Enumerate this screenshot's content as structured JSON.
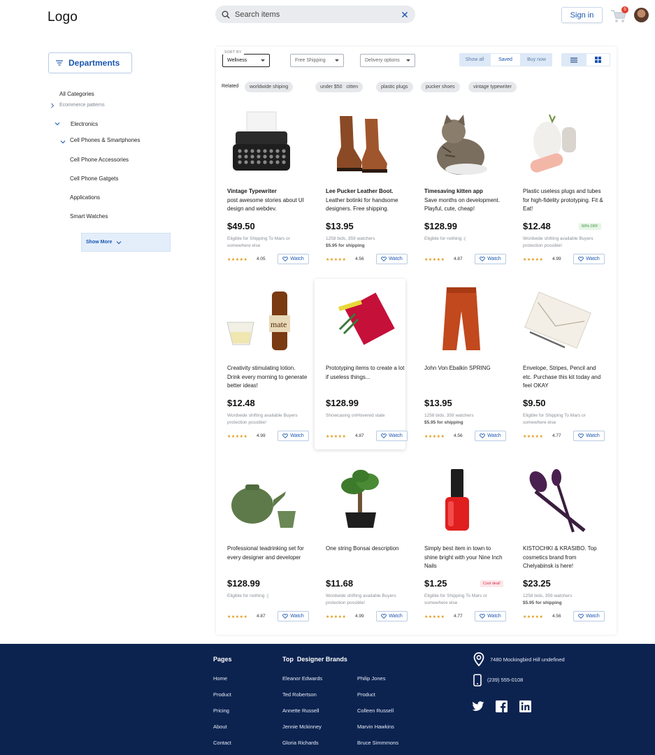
{
  "header": {
    "logo": "Logo",
    "search_placeholder": "Search items",
    "signin_label": "Sign in",
    "cart_count": "5",
    "cart_icon": "shopping-cart-icon",
    "avatar_icon": "user-avatar"
  },
  "sidebar": {
    "departments_label": "Departments",
    "all_categories": "All Categories",
    "ecommerce": "Ecommerce patterns",
    "electronics": "Electronics",
    "cell_phones": "Cell Phones & Smartphones",
    "items": [
      "Cell Phone Accessories",
      "Cell Phone Gatgets",
      "Applications",
      "Smart Watches"
    ],
    "show_more": "Show More"
  },
  "toolbar": {
    "sort_by_label": "SORT BY",
    "sort_value": "Wellness",
    "shipping_value": "Free Shipping",
    "delivery_value": "Delivery options",
    "segments": [
      "Show all",
      "Saved",
      "Buy now"
    ],
    "active_segment": "Saved"
  },
  "related": {
    "label": "Related",
    "chips": [
      "worldwide shiping",
      "under $50",
      "citten",
      "plastic plugs",
      "pucker shoes",
      "vintage typewriter"
    ]
  },
  "products": [
    {
      "title_bold": "Vintage Typewriter",
      "title_rest": "post awesome stories about UI design and webdev.",
      "price": "$49.50",
      "note": "Eligible for Shipping To Mars or somewhere else",
      "rating": "4.05",
      "watch": "Watch"
    },
    {
      "title_bold": "Lee Pucker Leather Boot.",
      "title_rest": "Leather botinki for handsome designers. Free shipping.",
      "price": "$13.95",
      "note": "1258 bids, 359 watchers",
      "note_bold": "$5.95 for shipping",
      "rating": "4.56",
      "watch": "Watch"
    },
    {
      "title_bold": "Timesaving kitten app",
      "title_rest": "Save months on development. Playful, cute, cheap!",
      "price": "$128.99",
      "note": "Eligible for nothing :(",
      "rating": "4.87",
      "watch": "Watch"
    },
    {
      "title_bold": "",
      "title_rest": "Plastic useless plugs and tubes for high-fidelity prototyping. Fit & Eat!",
      "price": "$12.48",
      "badge": "50% OFF",
      "note": "Wordwide shitting available Buyers protection possible!",
      "rating": "4.99",
      "watch": "Watch"
    },
    {
      "title_bold": "",
      "title_rest": "Creativity stimulating lotion. Drink every morning to generate better ideas!",
      "price": "$12.48",
      "note": "Wordwide shifting available Buyers protection possible!",
      "rating": "4.99",
      "watch": "Watch"
    },
    {
      "title_bold": "",
      "title_rest": "Prototyping items to create a lot if useless things...",
      "price": "$128.99",
      "note": "Showcasing onHovered state",
      "rating": "4.87",
      "watch": "Watch"
    },
    {
      "title_bold": "",
      "title_rest": "John Von Ebalkin SPRING",
      "price": "$13.95",
      "note": "1258 bids, 359 watchers",
      "note_bold": "$5.95 for shipping",
      "rating": "4.56",
      "watch": "Watch"
    },
    {
      "title_bold": "",
      "title_rest": "Envelope, Stripes, Pencil and etc. Purchase this kit today and feel OKAY",
      "price": "$9.50",
      "note": "Eligible for Shipping To Mars or somewhere else",
      "rating": "4.77",
      "watch": "Watch"
    },
    {
      "title_bold": "",
      "title_rest": "Professional teadrinking set for every designer and developer",
      "price": "$128.99",
      "note": "Eligible for nothing :(",
      "rating": "4.87",
      "watch": "Watch"
    },
    {
      "title_bold": "",
      "title_rest": "One string Bonsai description",
      "price": "$11.68",
      "note": "Wordwide shifting available Buyers protection possible!",
      "rating": "4.99",
      "watch": "Watch"
    },
    {
      "title_bold": "",
      "title_rest": "Simply best item in town to shine bright with your Nine Inch Nails",
      "price": "$1.25",
      "badge": "Cool deal!",
      "note": "Eligible for Shipping To Mars or somewhere else",
      "rating": "4.77",
      "watch": "Watch"
    },
    {
      "title_bold": "",
      "title_rest": "KISTOCHKI & KRASIBO. Top cosmetics brand from Chelyabinsk is here!",
      "price": "$23.25",
      "note": "1258 bids, 359 watchers",
      "note_bold": "$5.95 for shipping",
      "rating": "4.56",
      "watch": "Watch"
    }
  ],
  "footer": {
    "pages_heading": "Pages",
    "pages": [
      "Home",
      "Product",
      "Pricing",
      "About",
      "Contact"
    ],
    "brands_heading": "Top  Designer Brands",
    "brands_col1": [
      "Eleanor Edwards",
      "Ted Robertson",
      "Annette Russell",
      "Jennie Mckinney",
      "Gloria Richards"
    ],
    "brands_col2": [
      "Philip Jones",
      "Product",
      "Colleen Russell",
      "Marvin Hawkins",
      "Bruce Simmmons"
    ],
    "address": "7480 Mockingbird Hill undefined",
    "phone": "(239) 555-0108",
    "social": [
      "twitter-icon",
      "facebook-icon",
      "linkedin-icon"
    ]
  }
}
